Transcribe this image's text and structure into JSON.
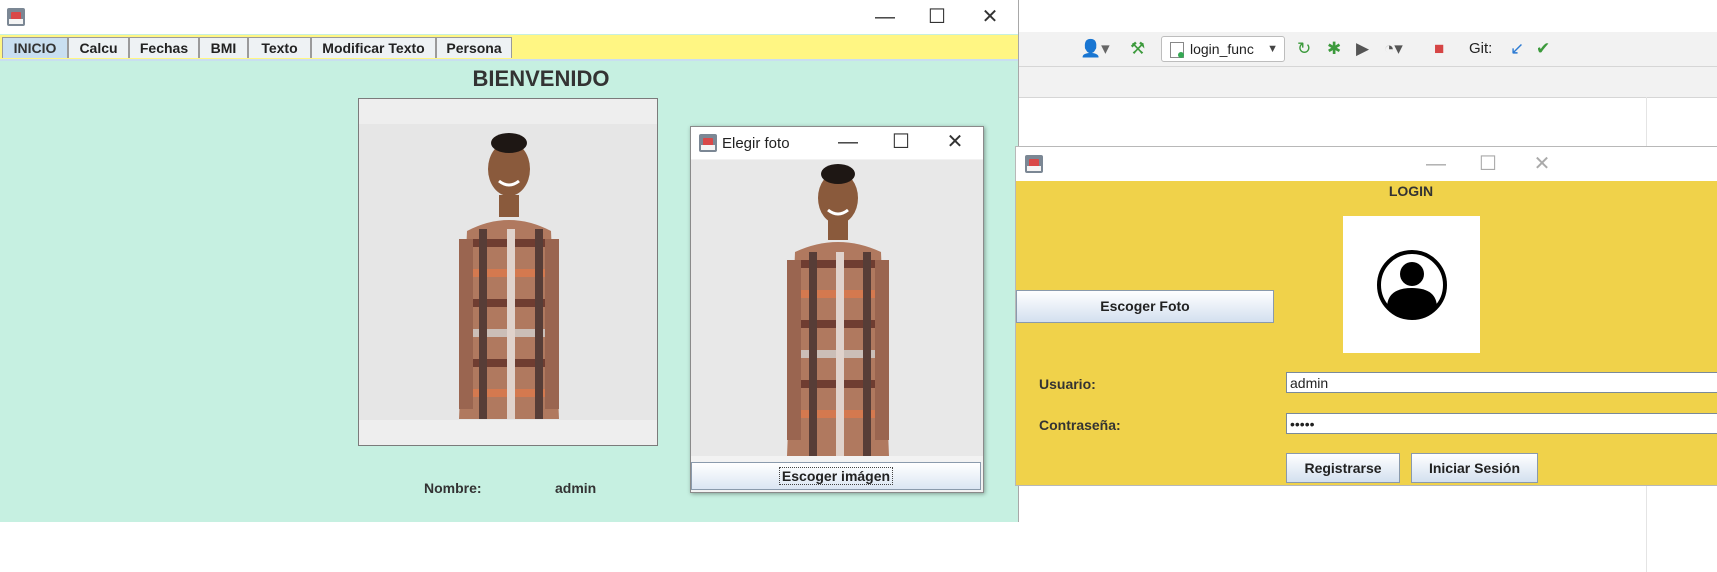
{
  "ide": {
    "run_config": "login_func",
    "git_label": "Git:"
  },
  "main_window": {
    "tabs": [
      "INICIO",
      "Calcu",
      "Fechas",
      "BMI",
      "Texto",
      "Modificar Texto",
      "Persona"
    ],
    "active_tab": "INICIO",
    "welcome": "BIENVENIDO",
    "name_label": "Nombre:",
    "name_value": "admin"
  },
  "photo_dialog": {
    "title": "Elegir foto",
    "choose_button": "Escoger imágen"
  },
  "login_window": {
    "heading": "LOGIN",
    "choose_photo_button": "Escoger Foto",
    "user_label": "Usuario:",
    "user_value": "admin",
    "password_label": "Contraseña:",
    "password_value": "•••••",
    "register_button": "Registrarse",
    "login_button": "Iniciar Sesión"
  },
  "colors": {
    "main_bg": "#c6f0e1",
    "tab_strip": "#fff683",
    "login_bg": "#f0d24a"
  }
}
